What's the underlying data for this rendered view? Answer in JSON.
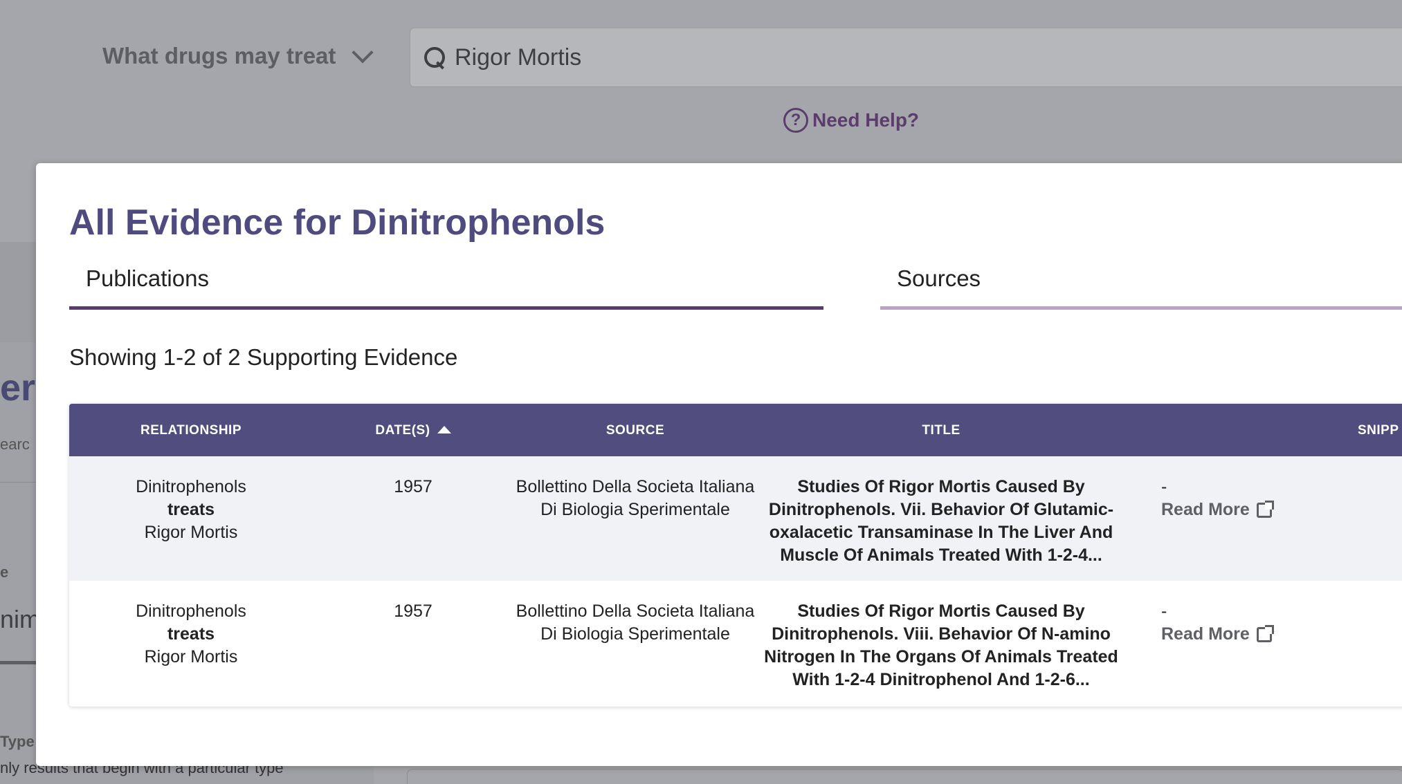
{
  "query": {
    "select_label": "What drugs may treat",
    "search_value": "Rigor Mortis",
    "help_label": "Need Help?"
  },
  "background_fragments": {
    "heading": "ers",
    "search": "earc",
    "label_e": "e",
    "value": "nim",
    "type_label": "Type",
    "type_hint": "nly results that begin with a particular type"
  },
  "modal": {
    "title": "All Evidence for Dinitrophenols",
    "tabs": [
      {
        "label": "Publications",
        "active": true
      },
      {
        "label": "Sources",
        "active": false
      }
    ],
    "showing": "Showing 1-2 of 2 Supporting Evidence",
    "table": {
      "headers": {
        "relationship": "RELATIONSHIP",
        "dates": "DATE(S)",
        "source": "SOURCE",
        "title": "TITLE",
        "snippet": "SNIPP"
      },
      "rows": [
        {
          "subject": "Dinitrophenols",
          "predicate": "treats",
          "object": "Rigor Mortis",
          "date": "1957",
          "source": "Bollettino Della Societa Italiana Di Biologia Sperimentale",
          "title": "Studies Of Rigor Mortis Caused By Dinitrophenols. Vii. Behavior Of Glutamic-oxalacetic Transaminase In The Liver And Muscle Of Animals Treated With 1-2-4...",
          "snippet": "-",
          "read_more": "Read More"
        },
        {
          "subject": "Dinitrophenols",
          "predicate": "treats",
          "object": "Rigor Mortis",
          "date": "1957",
          "source": "Bollettino Della Societa Italiana Di Biologia Sperimentale",
          "title": "Studies Of Rigor Mortis Caused By Dinitrophenols. Viii. Behavior Of N-amino Nitrogen In The Organs Of Animals Treated With 1-2-4 Dinitrophenol And 1-2-6...",
          "snippet": "-",
          "read_more": "Read More"
        }
      ]
    }
  },
  "colors": {
    "title": "#4f4b7e",
    "table_header": "#514d7f",
    "tab_active": "#5a3a70",
    "tab_inactive": "#b9a2c6",
    "help": "#5b3d6b"
  }
}
